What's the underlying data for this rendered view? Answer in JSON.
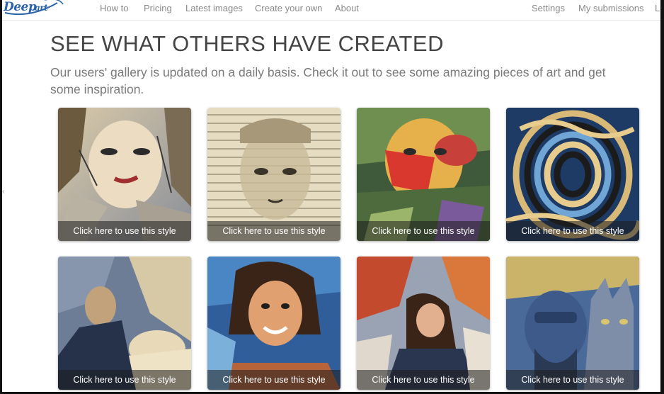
{
  "logo": {
    "text": "DeepArt.io"
  },
  "nav": {
    "left": [
      {
        "label": "How to"
      },
      {
        "label": "Pricing"
      },
      {
        "label": "Latest images"
      },
      {
        "label": "Create your own"
      },
      {
        "label": "About"
      }
    ],
    "right": [
      {
        "label": "Settings"
      },
      {
        "label": "My submissions"
      },
      {
        "label": "L"
      }
    ]
  },
  "header": {
    "title": "SEE WHAT OTHERS HAVE CREATED",
    "subtitle": "Our users' gallery is updated on a daily basis. Check it out to see some amazing pieces of art and get some inspiration."
  },
  "gallery": {
    "items": [
      {
        "overlay": "Click here to use this style",
        "art": "woman-sketch-portrait"
      },
      {
        "overlay": "Click here to use this style",
        "art": "newspaper-face-portrait"
      },
      {
        "overlay": "Click here to use this style",
        "art": "vegetable-face-portrait"
      },
      {
        "overlay": "Click here to use this style",
        "art": "swirl-line-portrait"
      },
      {
        "overlay": "Click here to use this style",
        "art": "man-with-dog-painting"
      },
      {
        "overlay": "Click here to use this style",
        "art": "smiling-woman-painting"
      },
      {
        "overlay": "Click here to use this style",
        "art": "woman-in-autumn-painting"
      },
      {
        "overlay": "Click here to use this style",
        "art": "man-and-cat-painting"
      }
    ]
  }
}
